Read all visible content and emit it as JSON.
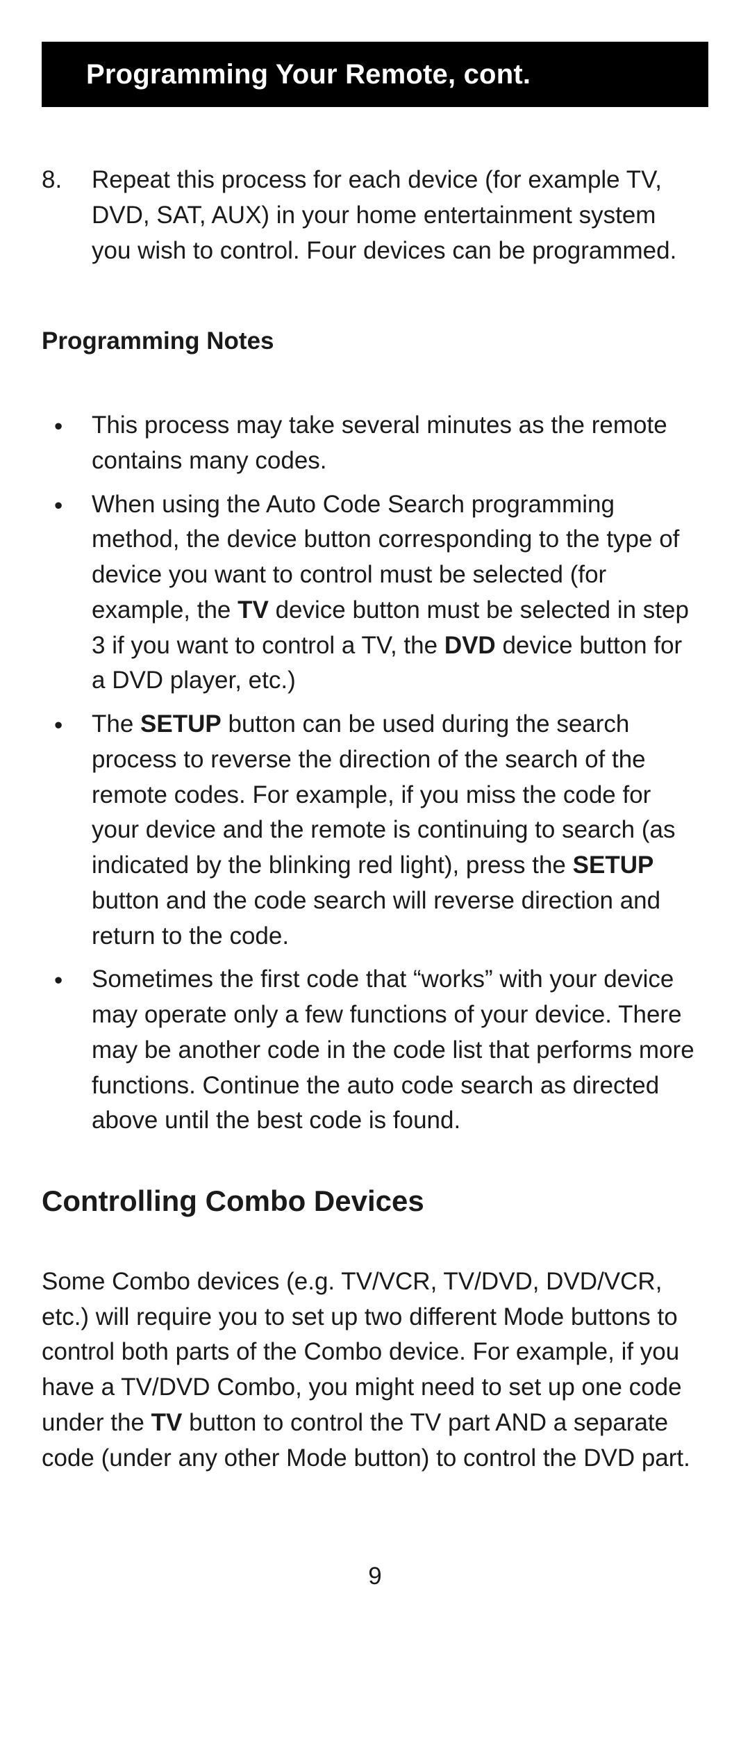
{
  "header": {
    "title": "Programming Your Remote, cont."
  },
  "step8": {
    "num": "8.",
    "text": "Repeat this process for each device (for example TV, DVD, SAT, AUX) in your home entertainment system you wish to control. Four devices can be programmed."
  },
  "notes_heading": "Programming Notes",
  "notes": {
    "b1": "This process may take several minutes as the remote contains many codes.",
    "b2_a": "When using the Auto Code Search programming method, the device button corresponding to the type of device you want to control must be selected (for example, the ",
    "b2_tv": "TV",
    "b2_b": " device button must be selected in step 3 if you want to control a TV, the ",
    "b2_dvd": "DVD",
    "b2_c": " device button for a DVD player, etc.)",
    "b3_a": "The ",
    "b3_setup1": "SETUP",
    "b3_b": " button can be used during the search process to reverse the direction of the search of the remote codes. For example, if you miss the code for your device and the remote is continuing to search (as indicated by the blinking red light), press the ",
    "b3_setup2": "SETUP",
    "b3_c": " button and the code search will reverse direction and return to the code.",
    "b4": "Sometimes the first code that “works” with your device may operate only a few functions of your device. There may be another code in the code list that performs more functions. Continue the auto code search as directed above until the best code is found."
  },
  "combo_heading": "Controlling Combo Devices",
  "combo": {
    "p_a": "Some Combo devices (e.g. TV/VCR, TV/DVD, DVD/VCR, etc.) will require you to set up two different Mode buttons to control both parts of the Combo device. For example, if you have a TV/DVD Combo, you might need to set up one code under the ",
    "p_tv": "TV",
    "p_b": " button to control the TV part AND a separate code (under any other Mode button) to control the DVD part."
  },
  "page_number": "9",
  "bullet": "•"
}
